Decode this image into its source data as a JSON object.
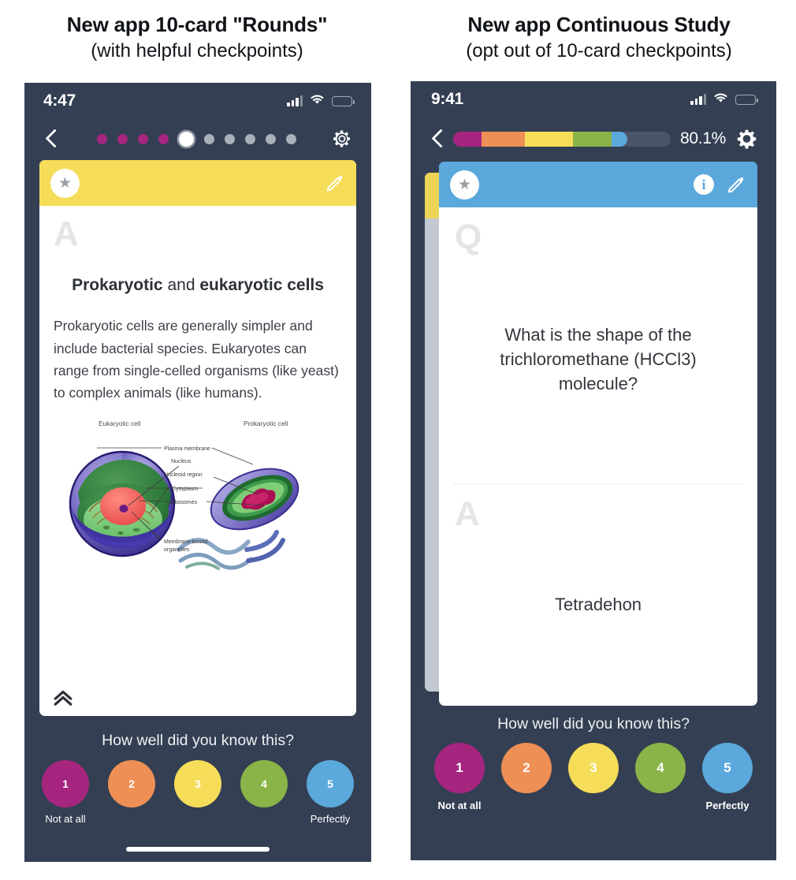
{
  "headings": {
    "left": {
      "line1": "New app 10-card \"Rounds\"",
      "line2": "(with helpful checkpoints)"
    },
    "right": {
      "line1": "New app Continuous Study",
      "line2": "(opt out of 10-card checkpoints)"
    }
  },
  "colors": {
    "app_background": "#343f53",
    "rating_1": "#a5257f",
    "rating_2": "#ee8f55",
    "rating_3": "#f5dd59",
    "rating_4": "#8ab447",
    "rating_5": "#5aa8dc",
    "card_header_answer": "#f5dd59",
    "card_header_question": "#5aa8dc",
    "progress_track": "#4a556b",
    "dot_done": "#a5257f",
    "dot_todo": "#aab0ba"
  },
  "rating_scale": {
    "question": "How well did you know this?",
    "items": [
      {
        "value": "1",
        "color": "#a5257f",
        "caption": "Not at all"
      },
      {
        "value": "2",
        "color": "#ee8f55",
        "caption": ""
      },
      {
        "value": "3",
        "color": "#f5dd59",
        "caption": ""
      },
      {
        "value": "4",
        "color": "#8ab447",
        "caption": ""
      },
      {
        "value": "5",
        "color": "#5aa8dc",
        "caption": "Perfectly"
      }
    ]
  },
  "left_phone": {
    "status": {
      "time": "4:47",
      "cellular": "cellular-signal-icon",
      "wifi": "wifi-icon",
      "battery": "battery-icon"
    },
    "nav": {
      "back": "chevron-left-icon",
      "settings": "gear-icon"
    },
    "round_progress": {
      "total": 10,
      "current_index": 5,
      "states": [
        "done",
        "done",
        "done",
        "done",
        "current",
        "todo",
        "todo",
        "todo",
        "todo",
        "todo"
      ]
    },
    "card": {
      "header_color": "#f5dd59",
      "star": "star-icon",
      "edit": "pencil-icon",
      "side_mark": "A",
      "title_part1": "Prokaryotic",
      "title_part2": " and ",
      "title_part3": "eukaryotic cells",
      "body": "Prokaryotic cells are generally simpler and include bacterial species. Eukaryotes can range from single-celled organisms (like yeast) to complex animals (like humans).",
      "collapse": "double-chevron-up-icon",
      "diagram": {
        "label_left": "Eukaryotic cell",
        "label_right": "Prokaryotic cell",
        "callouts": [
          "Plasma membrane",
          "Nucleus",
          "Nucleoid region",
          "Cytoplasm",
          "Ribosomes",
          "Membrane-bound organelles"
        ]
      }
    }
  },
  "right_phone": {
    "status": {
      "time": "9:41",
      "cellular": "cellular-signal-icon",
      "wifi": "wifi-icon",
      "battery": "battery-icon"
    },
    "nav": {
      "back": "chevron-left-icon",
      "settings": "gear-icon"
    },
    "mastery_progress": {
      "percent_label": "80.1%",
      "segments": [
        {
          "name": "1",
          "color": "#a5257f",
          "width_pct": 13
        },
        {
          "name": "2",
          "color": "#ee8f55",
          "width_pct": 20
        },
        {
          "name": "3",
          "color": "#f5dd59",
          "width_pct": 22
        },
        {
          "name": "4",
          "color": "#8ab447",
          "width_pct": 18
        },
        {
          "name": "5",
          "color": "#5aa8dc",
          "width_pct": 7
        }
      ]
    },
    "card": {
      "header_color": "#5aa8dc",
      "star": "star-icon",
      "info": "info-icon",
      "edit": "pencil-icon",
      "question_mark": "Q",
      "question": "What is the shape of the trichloromethane (HCCl3) molecule?",
      "answer_mark": "A",
      "answer": "Tetradehon"
    }
  }
}
